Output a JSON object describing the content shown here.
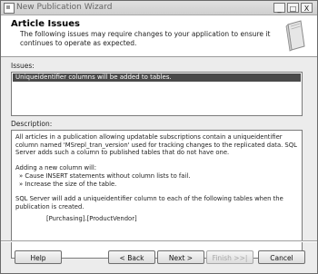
{
  "window": {
    "title": "New Publication Wizard",
    "controls": {
      "minimize": "_",
      "maximize": "□",
      "close": "X"
    }
  },
  "header": {
    "title": "Article Issues",
    "subtitle": "The following issues may require changes to your application to ensure it continues to operate as expected."
  },
  "issues": {
    "label": "Issues:",
    "items": [
      "Uniqueidentifier columns will be added to tables."
    ],
    "selected_index": 0
  },
  "description": {
    "label": "Description:",
    "paragraph1": "All articles in a publication allowing updatable subscriptions contain a uniqueidentifier column named 'MSrepl_tran_version' used for tracking changes to the replicated data. SQL Server adds such a column to published tables that do not have one.",
    "adding_intro": "Adding a new column will:",
    "bullets": [
      "» Cause INSERT statements without column lists to fail.",
      "» Increase the size of the table."
    ],
    "paragraph2": "SQL Server will add a uniqueidentifier column to each of the following tables when the publication is created.",
    "tables": [
      "[Purchasing].[ProductVendor]"
    ]
  },
  "buttons": {
    "help": "Help",
    "back": "< Back",
    "next": "Next >",
    "finish": "Finish >>|",
    "cancel": "Cancel"
  },
  "icons": {
    "app": "wizard-app-icon",
    "header": "book-icon"
  }
}
